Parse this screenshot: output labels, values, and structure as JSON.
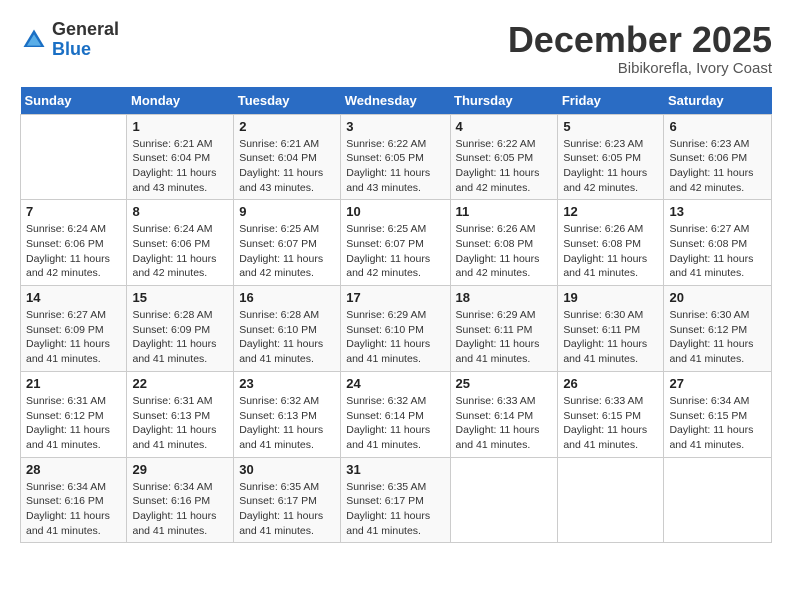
{
  "header": {
    "logo_general": "General",
    "logo_blue": "Blue",
    "month": "December 2025",
    "location": "Bibikorefla, Ivory Coast"
  },
  "days_of_week": [
    "Sunday",
    "Monday",
    "Tuesday",
    "Wednesday",
    "Thursday",
    "Friday",
    "Saturday"
  ],
  "weeks": [
    [
      {
        "day": "",
        "sunrise": "",
        "sunset": "",
        "daylight": ""
      },
      {
        "day": "1",
        "sunrise": "Sunrise: 6:21 AM",
        "sunset": "Sunset: 6:04 PM",
        "daylight": "Daylight: 11 hours and 43 minutes."
      },
      {
        "day": "2",
        "sunrise": "Sunrise: 6:21 AM",
        "sunset": "Sunset: 6:04 PM",
        "daylight": "Daylight: 11 hours and 43 minutes."
      },
      {
        "day": "3",
        "sunrise": "Sunrise: 6:22 AM",
        "sunset": "Sunset: 6:05 PM",
        "daylight": "Daylight: 11 hours and 43 minutes."
      },
      {
        "day": "4",
        "sunrise": "Sunrise: 6:22 AM",
        "sunset": "Sunset: 6:05 PM",
        "daylight": "Daylight: 11 hours and 42 minutes."
      },
      {
        "day": "5",
        "sunrise": "Sunrise: 6:23 AM",
        "sunset": "Sunset: 6:05 PM",
        "daylight": "Daylight: 11 hours and 42 minutes."
      },
      {
        "day": "6",
        "sunrise": "Sunrise: 6:23 AM",
        "sunset": "Sunset: 6:06 PM",
        "daylight": "Daylight: 11 hours and 42 minutes."
      }
    ],
    [
      {
        "day": "7",
        "sunrise": "Sunrise: 6:24 AM",
        "sunset": "Sunset: 6:06 PM",
        "daylight": "Daylight: 11 hours and 42 minutes."
      },
      {
        "day": "8",
        "sunrise": "Sunrise: 6:24 AM",
        "sunset": "Sunset: 6:06 PM",
        "daylight": "Daylight: 11 hours and 42 minutes."
      },
      {
        "day": "9",
        "sunrise": "Sunrise: 6:25 AM",
        "sunset": "Sunset: 6:07 PM",
        "daylight": "Daylight: 11 hours and 42 minutes."
      },
      {
        "day": "10",
        "sunrise": "Sunrise: 6:25 AM",
        "sunset": "Sunset: 6:07 PM",
        "daylight": "Daylight: 11 hours and 42 minutes."
      },
      {
        "day": "11",
        "sunrise": "Sunrise: 6:26 AM",
        "sunset": "Sunset: 6:08 PM",
        "daylight": "Daylight: 11 hours and 42 minutes."
      },
      {
        "day": "12",
        "sunrise": "Sunrise: 6:26 AM",
        "sunset": "Sunset: 6:08 PM",
        "daylight": "Daylight: 11 hours and 41 minutes."
      },
      {
        "day": "13",
        "sunrise": "Sunrise: 6:27 AM",
        "sunset": "Sunset: 6:08 PM",
        "daylight": "Daylight: 11 hours and 41 minutes."
      }
    ],
    [
      {
        "day": "14",
        "sunrise": "Sunrise: 6:27 AM",
        "sunset": "Sunset: 6:09 PM",
        "daylight": "Daylight: 11 hours and 41 minutes."
      },
      {
        "day": "15",
        "sunrise": "Sunrise: 6:28 AM",
        "sunset": "Sunset: 6:09 PM",
        "daylight": "Daylight: 11 hours and 41 minutes."
      },
      {
        "day": "16",
        "sunrise": "Sunrise: 6:28 AM",
        "sunset": "Sunset: 6:10 PM",
        "daylight": "Daylight: 11 hours and 41 minutes."
      },
      {
        "day": "17",
        "sunrise": "Sunrise: 6:29 AM",
        "sunset": "Sunset: 6:10 PM",
        "daylight": "Daylight: 11 hours and 41 minutes."
      },
      {
        "day": "18",
        "sunrise": "Sunrise: 6:29 AM",
        "sunset": "Sunset: 6:11 PM",
        "daylight": "Daylight: 11 hours and 41 minutes."
      },
      {
        "day": "19",
        "sunrise": "Sunrise: 6:30 AM",
        "sunset": "Sunset: 6:11 PM",
        "daylight": "Daylight: 11 hours and 41 minutes."
      },
      {
        "day": "20",
        "sunrise": "Sunrise: 6:30 AM",
        "sunset": "Sunset: 6:12 PM",
        "daylight": "Daylight: 11 hours and 41 minutes."
      }
    ],
    [
      {
        "day": "21",
        "sunrise": "Sunrise: 6:31 AM",
        "sunset": "Sunset: 6:12 PM",
        "daylight": "Daylight: 11 hours and 41 minutes."
      },
      {
        "day": "22",
        "sunrise": "Sunrise: 6:31 AM",
        "sunset": "Sunset: 6:13 PM",
        "daylight": "Daylight: 11 hours and 41 minutes."
      },
      {
        "day": "23",
        "sunrise": "Sunrise: 6:32 AM",
        "sunset": "Sunset: 6:13 PM",
        "daylight": "Daylight: 11 hours and 41 minutes."
      },
      {
        "day": "24",
        "sunrise": "Sunrise: 6:32 AM",
        "sunset": "Sunset: 6:14 PM",
        "daylight": "Daylight: 11 hours and 41 minutes."
      },
      {
        "day": "25",
        "sunrise": "Sunrise: 6:33 AM",
        "sunset": "Sunset: 6:14 PM",
        "daylight": "Daylight: 11 hours and 41 minutes."
      },
      {
        "day": "26",
        "sunrise": "Sunrise: 6:33 AM",
        "sunset": "Sunset: 6:15 PM",
        "daylight": "Daylight: 11 hours and 41 minutes."
      },
      {
        "day": "27",
        "sunrise": "Sunrise: 6:34 AM",
        "sunset": "Sunset: 6:15 PM",
        "daylight": "Daylight: 11 hours and 41 minutes."
      }
    ],
    [
      {
        "day": "28",
        "sunrise": "Sunrise: 6:34 AM",
        "sunset": "Sunset: 6:16 PM",
        "daylight": "Daylight: 11 hours and 41 minutes."
      },
      {
        "day": "29",
        "sunrise": "Sunrise: 6:34 AM",
        "sunset": "Sunset: 6:16 PM",
        "daylight": "Daylight: 11 hours and 41 minutes."
      },
      {
        "day": "30",
        "sunrise": "Sunrise: 6:35 AM",
        "sunset": "Sunset: 6:17 PM",
        "daylight": "Daylight: 11 hours and 41 minutes."
      },
      {
        "day": "31",
        "sunrise": "Sunrise: 6:35 AM",
        "sunset": "Sunset: 6:17 PM",
        "daylight": "Daylight: 11 hours and 41 minutes."
      },
      {
        "day": "",
        "sunrise": "",
        "sunset": "",
        "daylight": ""
      },
      {
        "day": "",
        "sunrise": "",
        "sunset": "",
        "daylight": ""
      },
      {
        "day": "",
        "sunrise": "",
        "sunset": "",
        "daylight": ""
      }
    ]
  ]
}
